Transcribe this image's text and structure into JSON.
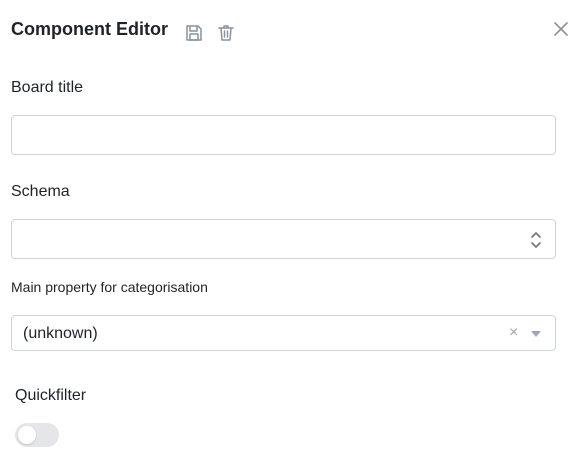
{
  "editor": {
    "title": "Component Editor",
    "icons": {
      "save": "save-icon",
      "delete": "trash-icon",
      "close": "close-icon"
    }
  },
  "form": {
    "board_title": {
      "label": "Board title",
      "value": ""
    },
    "schema": {
      "label": "Schema",
      "value": ""
    },
    "categorisation": {
      "label": "Main property for categorisation",
      "value": "(unknown)",
      "clear_glyph": "×"
    },
    "quickfilter": {
      "label": "Quickfilter",
      "enabled": false
    }
  },
  "colors": {
    "border": "#cfd4da",
    "icon": "#8a929b",
    "toggle_off": "#e4e6ea"
  }
}
